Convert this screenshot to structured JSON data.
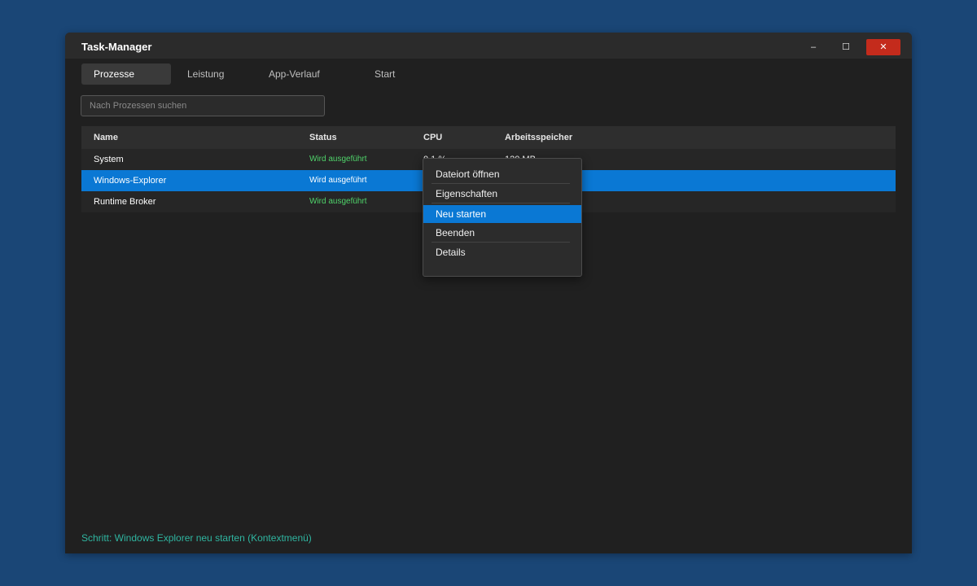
{
  "window": {
    "title": "Task-Manager"
  },
  "controls": {
    "minimize": "–",
    "maximize": "☐",
    "close": "✕"
  },
  "tabs": [
    {
      "label": "Prozesse",
      "active": true
    },
    {
      "label": "Leistung",
      "active": false
    },
    {
      "label": "App-Verlauf",
      "active": false
    },
    {
      "label": "Start",
      "active": false
    }
  ],
  "search": {
    "placeholder": "Nach Prozessen suchen",
    "value": ""
  },
  "table": {
    "columns": [
      "Name",
      "Status",
      "CPU",
      "Arbeitsspeicher"
    ],
    "rows": [
      {
        "name": "System",
        "status": "Wird ausgeführt",
        "cpu": "0,1 %",
        "memory": "120 MB",
        "selected": false
      },
      {
        "name": "Windows-Explorer",
        "status": "Wird ausgeführt",
        "cpu": "",
        "memory": "",
        "selected": true
      },
      {
        "name": "Runtime Broker",
        "status": "Wird ausgeführt",
        "cpu": "",
        "memory": "",
        "selected": false
      }
    ]
  },
  "context_menu": {
    "items": [
      {
        "label": "Dateiort öffnen",
        "highlighted": false
      },
      {
        "label": "Eigenschaften",
        "highlighted": false
      },
      {
        "label": "Neu starten",
        "highlighted": true
      },
      {
        "label": "Beenden",
        "highlighted": false
      },
      {
        "label": "Details",
        "highlighted": false
      }
    ]
  },
  "status_line": "Schritt: Windows Explorer neu starten (Kontextmenü)",
  "colors": {
    "accent": "#0a78d4",
    "close": "#c42b1c",
    "status_running": "#4fd36a",
    "step_text": "#2fb5a0",
    "desktop": "#1a4676"
  }
}
